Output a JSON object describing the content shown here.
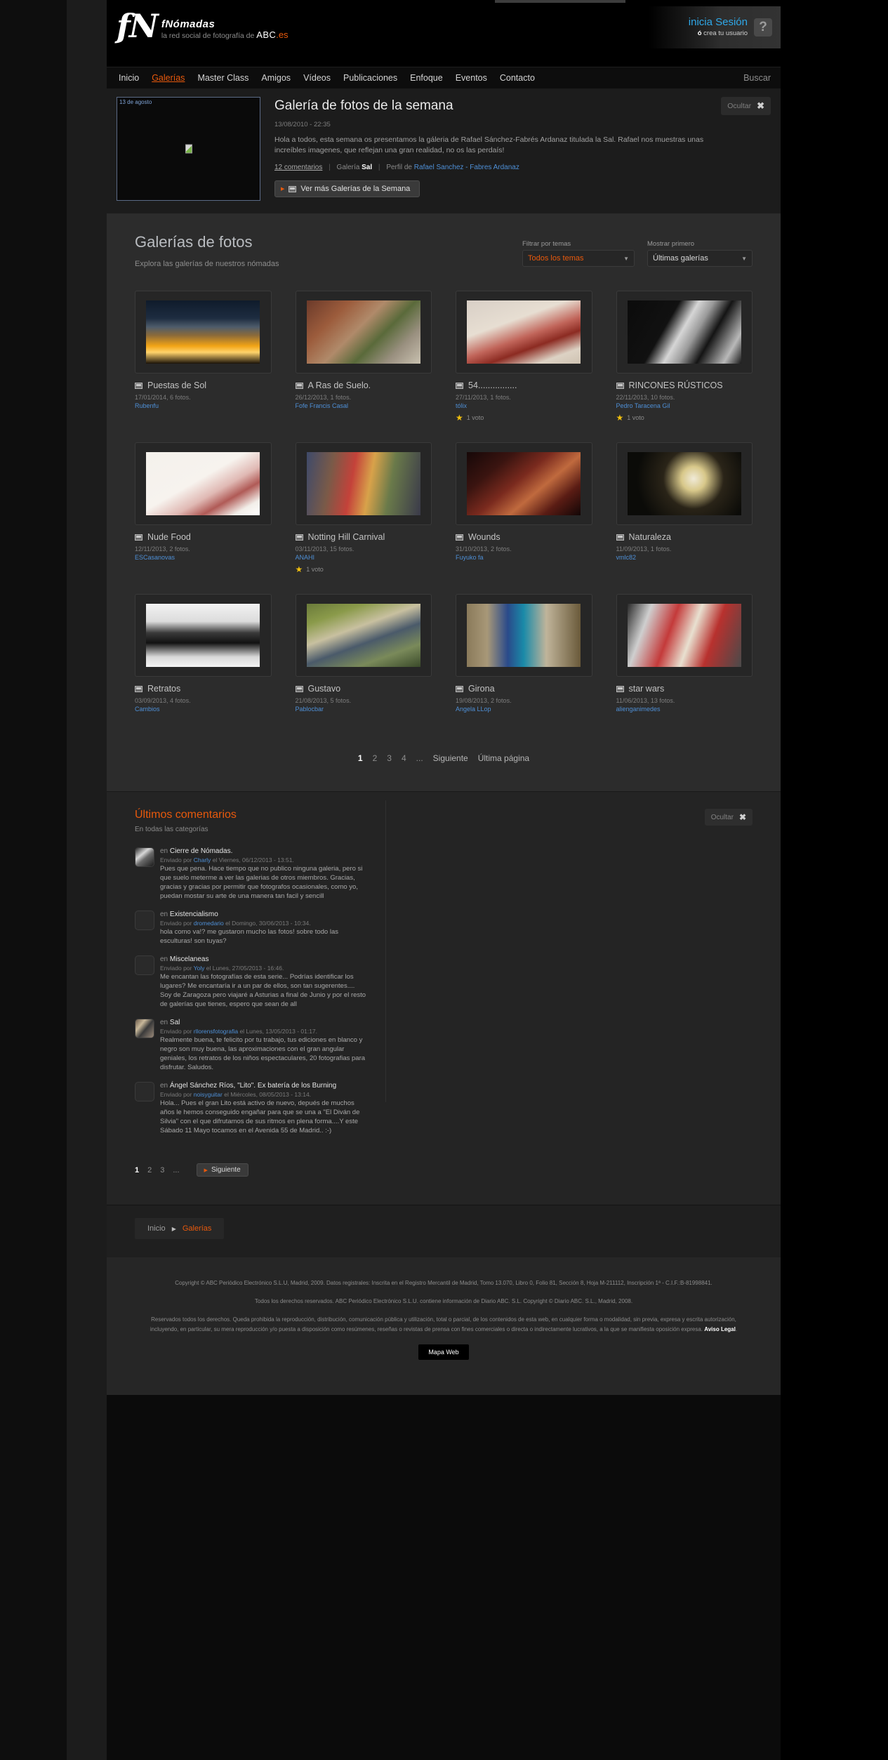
{
  "brand": {
    "logo_mark": "fN",
    "name": "fNómadas",
    "tagline": "la red social de fotografía de",
    "abc": "ABC",
    "es": ".es",
    "accent": "#e8590c",
    "link_blue": "#4e8fd6"
  },
  "account": {
    "login_label": "inicia Sesión",
    "create_prefix": "ó",
    "create_label": "crea tu usuario",
    "help_icon": "question-mark-icon"
  },
  "nav": {
    "items": [
      {
        "label": "Inicio",
        "active": false
      },
      {
        "label": "Galerías",
        "active": true
      },
      {
        "label": "Master Class",
        "active": false
      },
      {
        "label": "Amigos",
        "active": false
      },
      {
        "label": "Vídeos",
        "active": false
      },
      {
        "label": "Publicaciones",
        "active": false
      },
      {
        "label": "Enfoque",
        "active": false
      },
      {
        "label": "Eventos",
        "active": false
      },
      {
        "label": "Contacto",
        "active": false
      }
    ],
    "search_label": "Buscar"
  },
  "featured": {
    "thumb_caption": "13 de agosto",
    "title": "Galería de fotos de la semana",
    "date": "13/08/2010 - 22:35",
    "description": "Hola a todos, esta semana os presentamos la gáleria de Rafael Sánchez-Fabrés Ardanaz titulada la Sal. Rafael nos muestras unas increíbles imagenes, que reflejan una gran realidad, no os las perdaís!",
    "comments_link": "12 comentarios",
    "gallery_label": "Galería",
    "gallery_name": "Sal",
    "profile_label": "Perfil de",
    "profile_name": "Rafael Sanchez - Fabres Ardanaz",
    "button_label": "Ver más Galerías de la Semana",
    "hide_label": "Ocultar",
    "hide_icon": "close-x-icon"
  },
  "galleries": {
    "title": "Galerías de fotos",
    "subtitle": "Explora las galerías de nuestros nómadas",
    "filter_theme_label": "Filtrar por temas",
    "filter_theme_value": "Todos los temas",
    "sort_label": "Mostrar primero",
    "sort_value": "Últimas galerías",
    "cards": [
      {
        "title": "Puestas de Sol",
        "date": "17/01/2014, 6 fotos.",
        "author": "Rubenfu",
        "votes": null,
        "img": "linear-gradient(to bottom, #0f1b2b 0%, #1d2c40 28%, #4e5c6b 42%, #8a6a3a 55%, #f2a416 72%, #ffd36b 82%, #1a1208 100%)"
      },
      {
        "title": "A Ras de Suelo.",
        "date": "26/12/2013, 1 fotos.",
        "author": "Fofe Francis Casal",
        "votes": null,
        "img": "linear-gradient(135deg, #6b3a2a 0%, #9c5c3c 25%, #b08a6a 45%, #5a6a3a 62%, #9a9080 80%, #c9c2b0 100%)"
      },
      {
        "title": "54................",
        "date": "27/11/2013, 1 fotos.",
        "author": "tólix",
        "votes": "1 voto",
        "img": "linear-gradient(160deg, #d8cfc6 0%, #e7ded2 35%, #c1655a 55%, #8c2b22 68%, #ddd2c4 85%, #cfc3b2 100%)"
      },
      {
        "title": "RINCONES RÚSTICOS",
        "date": "22/11/2013, 10 fotos.",
        "author": "Pedro Taracena Gil",
        "votes": "1 voto",
        "img": "linear-gradient(120deg, #0b0b0b 0%, #111 35%, #d6d6d6 48%, #9a9a9a 58%, #141414 70%, #b9b9b9 88%, #1a1a1a 100%)"
      },
      {
        "title": "Nude Food",
        "date": "12/11/2013, 2 fotos.",
        "author": "ESCasanovas",
        "votes": null,
        "img": "linear-gradient(150deg, #f4f1ec 0%, #f7f3ee 45%, #e0b9b4 62%, #b05a56 74%, #f2eee9 88%, #ffffff 100%)"
      },
      {
        "title": "Notting Hill Carnival",
        "date": "03/11/2013, 15 fotos.",
        "author": "ANAHI",
        "votes": "1 voto",
        "img": "linear-gradient(100deg, #3e4a6a 0%, #7a5a48 22%, #c4423a 40%, #d8a24a 55%, #6a7a4a 72%, #3a3a4a 100%)"
      },
      {
        "title": "Wounds",
        "date": "31/10/2013, 2 fotos.",
        "author": "Fuyuko fa",
        "votes": null,
        "img": "linear-gradient(140deg, #160808 0%, #3a1410 25%, #7a2a1e 45%, #c06a3e 62%, #5a1c14 80%, #120606 100%)"
      },
      {
        "title": "Naturaleza",
        "date": "11/09/2013, 1 fotos.",
        "author": "vmlc82",
        "votes": null,
        "img": "radial-gradient(circle at 58% 42%, #f0ead8 0%, #d8c88a 16%, #2a2418 40%, #0b0b08 75%)"
      },
      {
        "title": "Retratos",
        "date": "03/09/2013, 4 fotos.",
        "author": "Cambios",
        "votes": null,
        "img": "linear-gradient(180deg, #f2f2f2 0%, #dcdcdc 28%, #3a3a3a 46%, #111 62%, #d8d8d8 84%, #f4f4f4 100%)"
      },
      {
        "title": "Gustavo",
        "date": "21/08/2013, 5 fotos.",
        "author": "Pablocbar",
        "votes": null,
        "img": "linear-gradient(160deg, #6a7a3a 0%, #8a9a4a 20%, #c8c0a0 40%, #4a5a6a 58%, #7a8a5a 78%, #3a4a2a 100%)"
      },
      {
        "title": "Girona",
        "date": "19/08/2013, 2 fotos.",
        "author": "Angela LLop",
        "votes": null,
        "img": "linear-gradient(90deg, #8a7a5a 0%, #a89878 18%, #2a4a8a 36%, #1a8aa8 50%, #c0b49a 70%, #6a5a3a 100%)"
      },
      {
        "title": "star wars",
        "date": "11/06/2013, 13 fotos.",
        "author": "alienganimedes",
        "votes": null,
        "img": "linear-gradient(110deg, #2a2a2a 0%, #cfcfcf 18%, #c43a3a 38%, #e8e0d0 55%, #b8312e 72%, #4a4a4a 100%)"
      }
    ],
    "pagination": {
      "pages": [
        "1",
        "2",
        "3",
        "4",
        "..."
      ],
      "current": "1",
      "next_label": "Siguiente",
      "last_label": "Última página"
    }
  },
  "comments": {
    "title": "Últimos comentarios",
    "subtitle": "En todas las categorías",
    "hide_label": "Ocultar",
    "hide_icon": "close-x-icon",
    "items": [
      {
        "in_prefix": "en",
        "in_target": "Cierre de Nómadas.",
        "by_prefix": "Enviado por",
        "author": "Charly",
        "when": "el Viernes, 06/12/2013 - 13:51.",
        "text": "Pues que pena. Hace tiempo que no publico ninguna galeria, pero si que suelo meterme a ver las galerias de otros miembros. Gracias, gracias y gracias por permitir que fotografos ocasionales, como yo, puedan mostar su arte de una manera tan facil y sencill",
        "has_avatar": true
      },
      {
        "in_prefix": "en",
        "in_target": "Existencialismo",
        "by_prefix": "Enviado por",
        "author": "dromedario",
        "when": "el Domingo, 30/06/2013 - 10:34.",
        "text": "hola como va!? me gustaron mucho las fotos! sobre todo las esculturas! son tuyas?",
        "has_avatar": false
      },
      {
        "in_prefix": "en",
        "in_target": "Miscelaneas",
        "by_prefix": "Enviado por",
        "author": "Yoly",
        "when": "el Lunes, 27/05/2013 - 16:46.",
        "text": "Me encantan las fotografías de esta serie... Podrías identificar los lugares? Me encantaría ir a un par de ellos, son tan sugerentes.... Soy de Zaragoza pero viajaré a Asturias a final de Junio y por el resto de galerías que tienes, espero que sean de all",
        "has_avatar": false
      },
      {
        "in_prefix": "en",
        "in_target": "Sal",
        "by_prefix": "Enviado por",
        "author": "rllorensfotografia",
        "when": "el Lunes, 13/05/2013 - 01:17.",
        "text": "Realmente buena, te felicito por tu trabajo, tus ediciones en blanco y negro son muy buena, las aproximaciones con el gran angular geniales, los retratos de los niños espectaculares, 20 fotografias para disfrutar. Saludos.",
        "has_avatar": true
      },
      {
        "in_prefix": "en",
        "in_target": "Ángel Sánchez Ríos, \"Lito\". Ex batería de los Burning",
        "by_prefix": "Enviado por",
        "author": "noisyguitar",
        "when": "el Miércoles, 08/05/2013 - 13:14.",
        "text": "Hola... Pues el gran Lito está activo de nuevo, depués de muchos años le hemos conseguido engañar para que se una a \"El Diván de Silvia\" con el que difrutamos de sus ritmos en plena forma....Y este Sábado 11 Mayo tocamos en el Avenida 55 de Madrid.. :-)",
        "has_avatar": false
      }
    ],
    "pagination": {
      "pages": [
        "1",
        "2",
        "3",
        "..."
      ],
      "current": "1",
      "next_label": "Siguiente"
    }
  },
  "breadcrumb": {
    "home": "Inicio",
    "arrow_icon": "triangle-right-icon",
    "current": "Galerías"
  },
  "footer": {
    "line1": "Copyright © ABC Periódico Electrónico S.L.U, Madrid, 2009. Datos registrales: Inscrita en el Registro Mercantil de Madrid, Tomo 13.070, Libro 0, Folio 81, Sección 8, Hoja M-211112, Inscripción 1ª - C.I.F.:B-81998841.",
    "line2": "Todos los derechos reservados. ABC Periódico Electrónico S.L.U. contiene información de Diario ABC. S.L. Copyright © Diario ABC. S.L., Madrid, 2008.",
    "line3": "Reservados todos los derechos. Queda prohibida la reproducción, distribución, comunicación pública y utilización, total o parcial, de los contenidos de esta web, en cualquier forma o modalidad, sin previa, expresa y escrita autorización, incluyendo, en particular, su mera reproducción y/o puesta a disposición como resúmenes, reseñas o revistas de prensa con fines comerciales o directa o indirectamente lucrativos, a la que se manifiesta oposición expresa.",
    "legal_link": "Aviso Legal",
    "map_button": "Mapa Web"
  }
}
